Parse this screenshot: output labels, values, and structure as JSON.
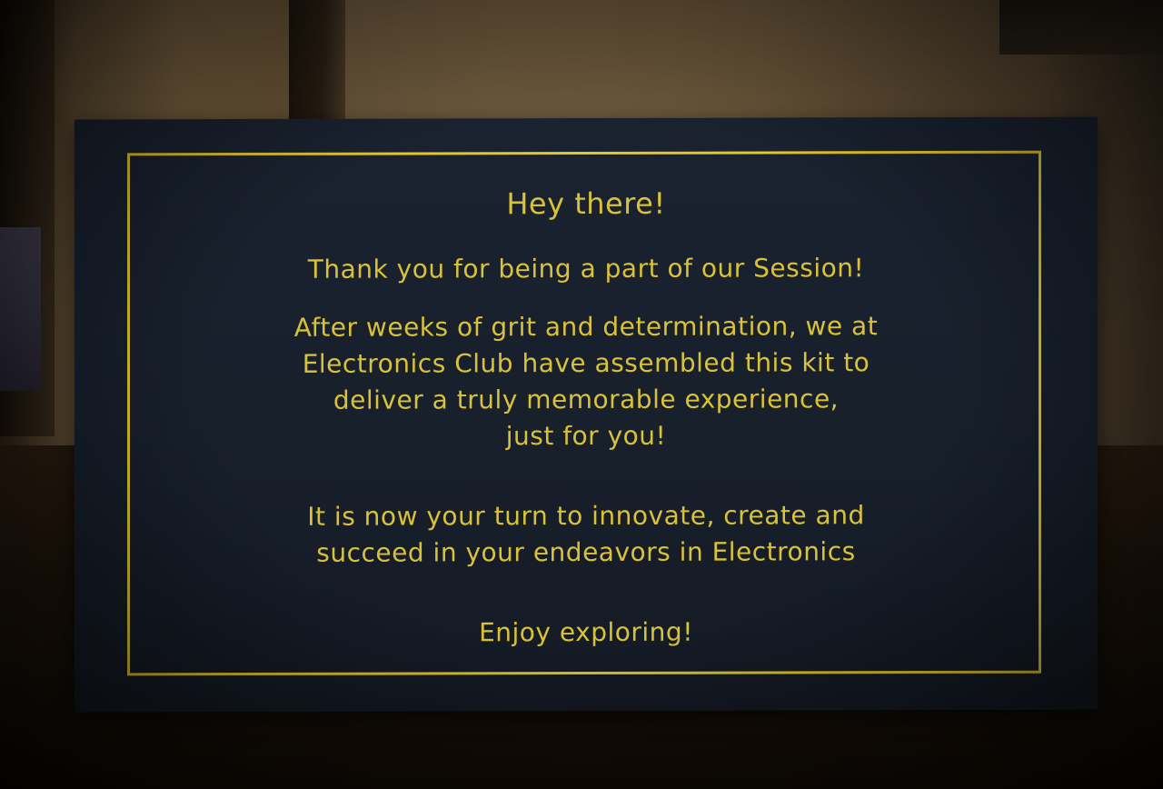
{
  "card": {
    "greeting": "Hey there!",
    "thanks": "Thank you for being a part of our Session!",
    "paragraph1": [
      "After weeks of grit and determination, we at",
      "Electronics Club have assembled this kit to",
      "deliver a truly memorable experience,",
      "just for you!"
    ],
    "paragraph2": [
      "It is now your turn to innovate, create and",
      "succeed in your endeavors in Electronics"
    ],
    "signoff": "Enjoy exploring!"
  },
  "colors": {
    "card_background": "#18202c",
    "text_gold": "#d9c23a",
    "frame_gold": "#e1c62c"
  }
}
